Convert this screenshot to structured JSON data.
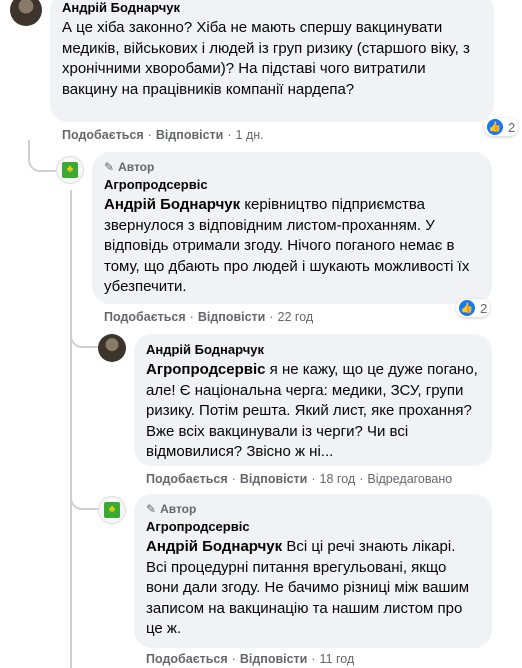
{
  "comments": [
    {
      "author": "Андрій Боднарчук",
      "text": "А це хіба законно? Хіба не мають спершу вакцинувати медиків, військових і людей із груп ризику (старшого віку, з хронічними хворобами)? На підставі чого витратили вакцину на працівників компанії нардепа?",
      "like_label": "Подобається",
      "reply_label": "Відповісти",
      "time": "1 дн.",
      "reactions": "2"
    },
    {
      "badge": "Автор",
      "author": "Агропродсервіс",
      "mention": "Андрій Боднарчук",
      "text": " керівництво підприємства звернулося з відповідним листом-проханням. У відповідь отримали згоду. Нічого поганого немає в тому, що дбають про людей і шукають можливості їх убезпечити.",
      "like_label": "Подобається",
      "reply_label": "Відповісти",
      "time": "22 год",
      "reactions": "2"
    },
    {
      "author": "Андрій Боднарчук",
      "mention": "Агропродсервіс",
      "text": " я не кажу, що це дуже погано, але! Є національна черга: медики, ЗСУ, групи ризику. Потім решта. Який лист, яке прохання? Вже всіх вакцинували із черги? Чи всі відмовилися? Звісно ж ні...",
      "like_label": "Подобається",
      "reply_label": "Відповісти",
      "time": "18 год",
      "edited": "Відредаговано"
    },
    {
      "badge": "Автор",
      "author": "Агропродсервіс",
      "mention": "Андрій Боднарчук",
      "text": " Всі ці речі знають лікарі. Всі процедурні питання врегульовані, якщо вони дали згоду. Не бачимо різниці між вашим записом на вакцинацію та нашим листом про це ж.",
      "like_label": "Подобається",
      "reply_label": "Відповісти",
      "time": "11 год"
    }
  ],
  "icons": {
    "like": "like-icon",
    "pen": "pen-icon",
    "logo": "company-logo-icon"
  },
  "colors": {
    "bubble": "#f0f2f5",
    "meta": "#65676b",
    "like": "#1877f2"
  }
}
